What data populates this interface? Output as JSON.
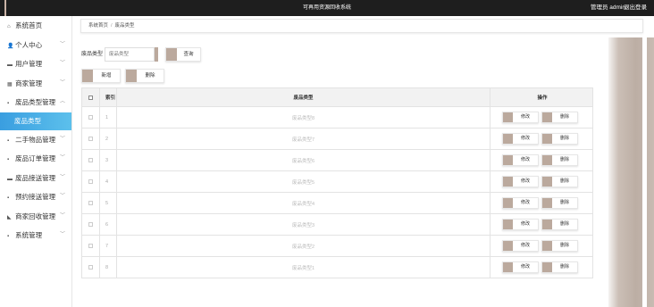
{
  "header": {
    "title": "可再用资源回收系统",
    "user_label": "管理员 admin",
    "logout_label": "退出登录"
  },
  "sidebar": {
    "items": [
      {
        "label": "系统首页",
        "icon": "home-icon",
        "glyph": "⌂",
        "arrow": ""
      },
      {
        "label": "个人中心",
        "icon": "user-icon",
        "glyph": "👤",
        "arrow": "﹀"
      },
      {
        "label": "用户管理",
        "icon": "monitor-icon",
        "glyph": "▬",
        "arrow": "﹀"
      },
      {
        "label": "商家管理",
        "icon": "store-icon",
        "glyph": "▦",
        "arrow": "﹀"
      },
      {
        "label": "废品类型管理",
        "icon": "grid-icon",
        "glyph": "▪",
        "arrow": "︿"
      },
      {
        "label": "二手物品管理",
        "icon": "grid-icon",
        "glyph": "▪",
        "arrow": "﹀"
      },
      {
        "label": "废品订单管理",
        "icon": "grid-icon",
        "glyph": "▪",
        "arrow": "﹀"
      },
      {
        "label": "废品接送管理",
        "icon": "doc-icon",
        "glyph": "▬",
        "arrow": "﹀"
      },
      {
        "label": "预约接送管理",
        "icon": "grid-icon",
        "glyph": "▪",
        "arrow": "﹀"
      },
      {
        "label": "商家回收管理",
        "icon": "truck-icon",
        "glyph": "◣",
        "arrow": "﹀"
      },
      {
        "label": "系统管理",
        "icon": "grid-icon",
        "glyph": "▪",
        "arrow": "﹀"
      }
    ],
    "active_sub": "废品类型"
  },
  "breadcrumb": {
    "home": "系统首页",
    "separator": "/",
    "current": "废品类型"
  },
  "search": {
    "label": "废品类型",
    "placeholder": "废品类型",
    "button": "查询"
  },
  "actions": {
    "add": "新增",
    "delete": "删除"
  },
  "table": {
    "headers": {
      "index": "索引",
      "name": "废品类型",
      "op": "操作"
    },
    "rows": [
      {
        "index": "1",
        "name": "废品类型8"
      },
      {
        "index": "2",
        "name": "废品类型7"
      },
      {
        "index": "3",
        "name": "废品类型6"
      },
      {
        "index": "4",
        "name": "废品类型5"
      },
      {
        "index": "5",
        "name": "废品类型4"
      },
      {
        "index": "6",
        "name": "废品类型3"
      },
      {
        "index": "7",
        "name": "废品类型2"
      },
      {
        "index": "8",
        "name": "废品类型1"
      }
    ],
    "edit_label": "修改",
    "delete_label": "删除"
  },
  "colors": {
    "accent": "#bba99d",
    "topbar": "#1e1e1e",
    "active_menu": "#3a9ee0"
  }
}
